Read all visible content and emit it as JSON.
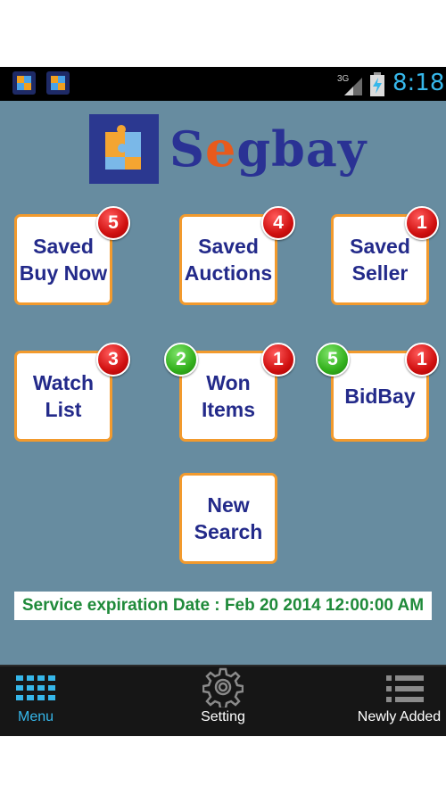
{
  "status_bar": {
    "network": "3G",
    "time": "8:18",
    "notification_icons": [
      "app-icon",
      "app-icon"
    ]
  },
  "header": {
    "logo_icon": "puzzle-icon",
    "logo_text_prefix": "S",
    "logo_text_e": "e",
    "logo_text_suffix": "gbay"
  },
  "tiles": [
    {
      "id": "saved-buy-now",
      "label": "Saved\nBuy Now",
      "badges": [
        {
          "color": "red",
          "value": "5"
        }
      ]
    },
    {
      "id": "saved-auctions",
      "label": "Saved\nAuctions",
      "badges": [
        {
          "color": "red",
          "value": "4"
        }
      ]
    },
    {
      "id": "saved-seller",
      "label": "Saved\nSeller",
      "badges": [
        {
          "color": "red",
          "value": "1"
        }
      ]
    },
    {
      "id": "watch-list",
      "label": "Watch\nList",
      "badges": [
        {
          "color": "red",
          "value": "3"
        }
      ]
    },
    {
      "id": "won-items",
      "label": "Won\nItems",
      "badges": [
        {
          "color": "green",
          "value": "2"
        },
        {
          "color": "red",
          "value": "1"
        }
      ]
    },
    {
      "id": "bidbay",
      "label": "BidBay",
      "badges": [
        {
          "color": "green",
          "value": "5"
        },
        {
          "color": "red",
          "value": "1"
        }
      ]
    },
    {
      "id": "new-search",
      "label": "New\nSearch",
      "badges": []
    }
  ],
  "expiration": {
    "text": "Service expiration Date : Feb 20 2014 12:00:00 AM"
  },
  "bottom_nav": {
    "menu": "Menu",
    "setting": "Setting",
    "newly_added": "Newly Added",
    "active": "menu",
    "accent": "#36b7ea"
  }
}
